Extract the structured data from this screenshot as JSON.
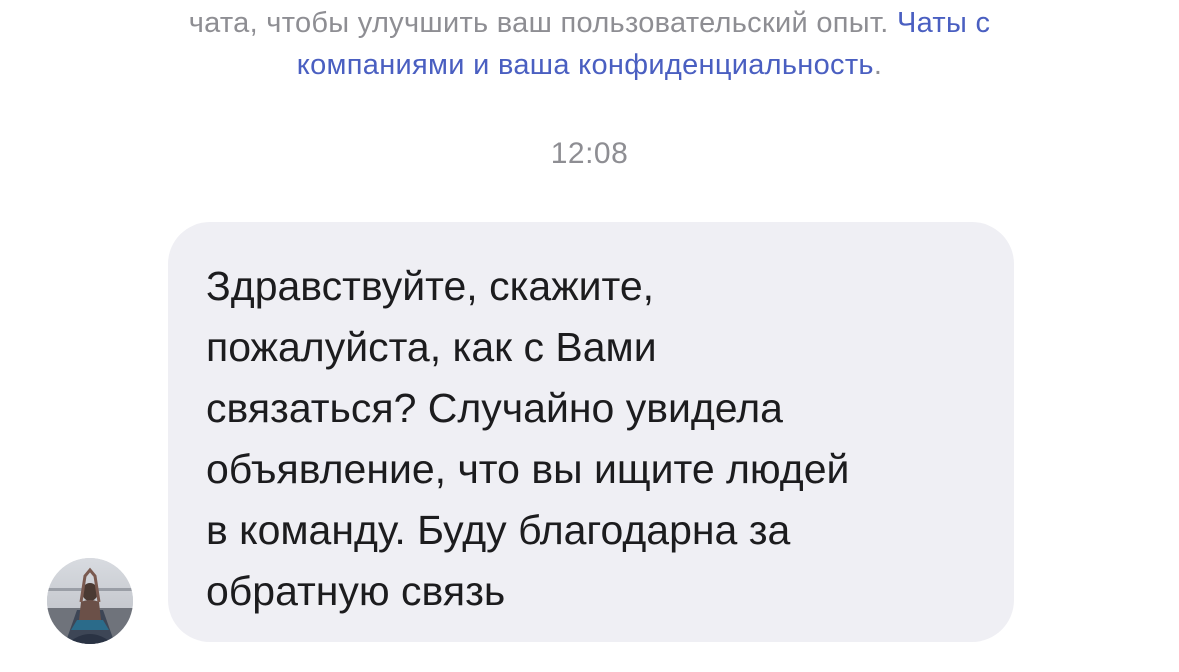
{
  "notice": {
    "text": "чата, чтобы улучшить ваш пользовательский опыт. ",
    "link_line1": "Чаты с",
    "link_line2": "компаниями и ваша конфиденциальность",
    "end": "."
  },
  "timestamp": "12:08",
  "message": {
    "text": "Здравствуйте, скажите,\nпожалуйста, как с Вами\nсвязаться? Случайно увидела\nобъявление, что вы ищите людей\nв команду. Буду благодарна за\nобратную связь"
  },
  "colors": {
    "bubble": "#efeff4",
    "link": "#4a5fc1",
    "muted": "#8e8e93",
    "text": "#1c1c1e"
  },
  "icons": {
    "avatar": "user-avatar-photo"
  }
}
